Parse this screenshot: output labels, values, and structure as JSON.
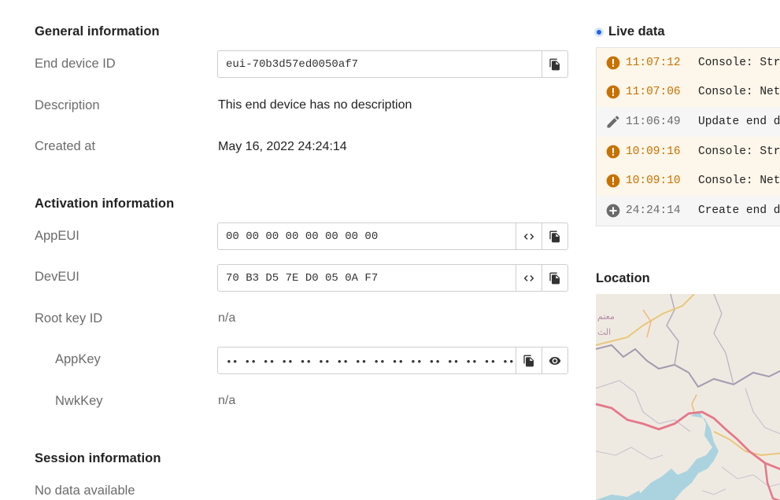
{
  "general": {
    "title": "General information",
    "device_id_label": "End device ID",
    "device_id_value": "eui-70b3d57ed0050af7",
    "description_label": "Description",
    "description_value": "This end device has no description",
    "created_label": "Created at",
    "created_value": "May 16, 2022 24:24:14"
  },
  "activation": {
    "title": "Activation information",
    "appeui_label": "AppEUI",
    "appeui_value": "00 00 00 00 00 00 00 00",
    "deveui_label": "DevEUI",
    "deveui_value": "70 B3 D5 7E D0 05 0A F7",
    "rootkey_label": "Root key ID",
    "rootkey_value": "n/a",
    "appkey_label": "AppKey",
    "appkey_value": "•• •• •• •• •• •• •• •• •• •• •• •• •• •• •• ••",
    "nwkkey_label": "NwkKey",
    "nwkkey_value": "n/a"
  },
  "session": {
    "title": "Session information",
    "empty": "No data available"
  },
  "live": {
    "title": "Live data",
    "events": [
      {
        "icon": "warning-icon",
        "kind": "warn",
        "time": "11:07:12",
        "message": "Console: Str"
      },
      {
        "icon": "warning-icon",
        "kind": "warn",
        "time": "11:07:06",
        "message": "Console: Net"
      },
      {
        "icon": "edit-icon",
        "kind": "plain",
        "time": "11:06:49",
        "message": "Update end d"
      },
      {
        "icon": "warning-icon",
        "kind": "warn",
        "time": "10:09:16",
        "message": "Console: Str"
      },
      {
        "icon": "warning-icon",
        "kind": "warn",
        "time": "10:09:10",
        "message": "Console: Net"
      },
      {
        "icon": "add-circle-icon",
        "kind": "plain",
        "time": "24:24:14",
        "message": "Create end d"
      }
    ]
  },
  "location": {
    "title": "Location",
    "map_text": "معتم"
  },
  "icons": {
    "copy": "copy-icon",
    "code": "code-icon",
    "show": "eye-icon"
  },
  "colors": {
    "warning": "#c77200",
    "warning_bg": "#fdf6ea",
    "live_dot": "#1c66e8"
  }
}
